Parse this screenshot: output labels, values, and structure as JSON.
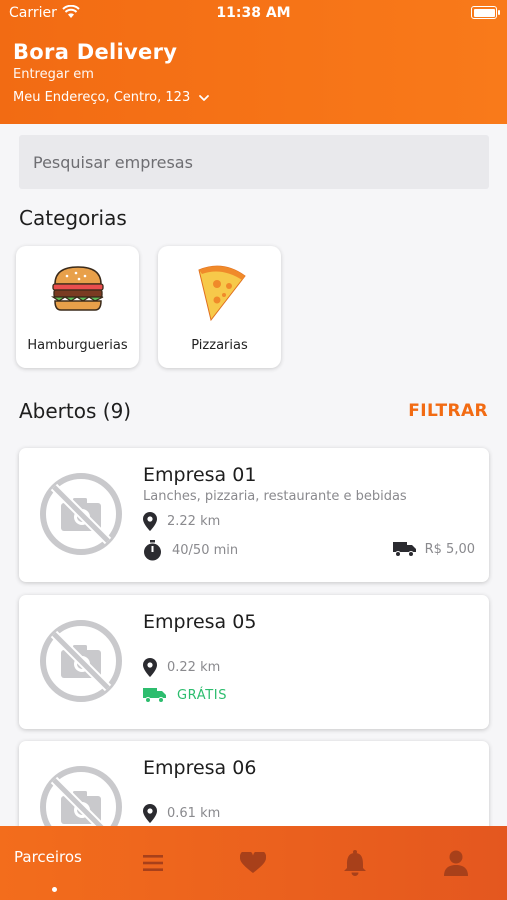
{
  "status_bar": {
    "carrier": "Carrier",
    "time": "11:38 AM"
  },
  "header": {
    "title": "Bora Delivery",
    "deliver_label": "Entregar em",
    "address": "Meu Endereço, Centro, 123"
  },
  "search": {
    "placeholder": "Pesquisar empresas"
  },
  "categories": {
    "title": "Categorias",
    "items": [
      {
        "label": "Hamburguerias",
        "icon": "burger-icon"
      },
      {
        "label": "Pizzarias",
        "icon": "pizza-icon"
      }
    ]
  },
  "open_section": {
    "title": "Abertos (9)",
    "filter_label": "FILTRAR"
  },
  "companies": [
    {
      "name": "Empresa 01",
      "description": "Lanches, pizzaria, restaurante e bebidas",
      "distance": "2.22 km",
      "time": "40/50 min",
      "fee": "R$ 5,00"
    },
    {
      "name": "Empresa 05",
      "distance": "0.22 km",
      "fee": "GRÁTIS"
    },
    {
      "name": "Empresa 06",
      "distance": "0.61 km"
    }
  ],
  "tabbar": {
    "active_label": "Parceiros",
    "items": [
      "store-icon",
      "list-icon",
      "heart-icon",
      "bell-icon",
      "user-icon"
    ]
  },
  "colors": {
    "primary": "#f26b13",
    "free": "#2dbd6e",
    "background": "#f6f6f8"
  }
}
